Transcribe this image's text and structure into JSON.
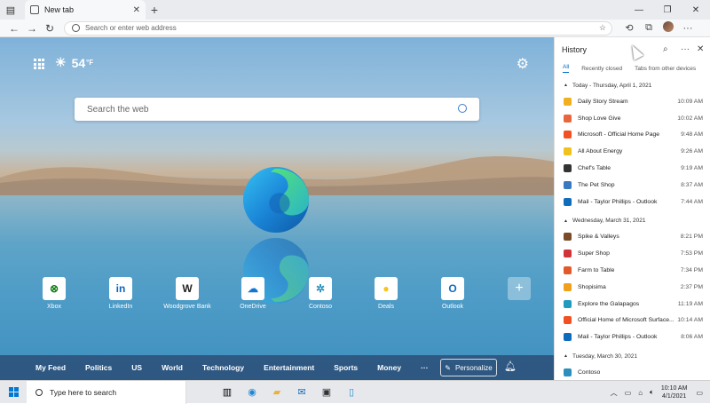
{
  "browser": {
    "tab_title": "New tab",
    "address_placeholder": "Search or enter web address"
  },
  "newtab": {
    "temperature": "54",
    "temp_unit": "°F",
    "search_placeholder": "Search the web",
    "tiles": [
      {
        "label": "Xbox",
        "icon": "xbox-icon",
        "glyph": "⊗",
        "color": "#107c10"
      },
      {
        "label": "LinkedIn",
        "icon": "linkedin-icon",
        "glyph": "in",
        "color": "#0a66c2"
      },
      {
        "label": "Woodgrove Bank",
        "icon": "woodgrove-bank-icon",
        "glyph": "W",
        "color": "#222222"
      },
      {
        "label": "OneDrive",
        "icon": "onedrive-icon",
        "glyph": "☁",
        "color": "#0f78d4"
      },
      {
        "label": "Contoso",
        "icon": "contoso-icon",
        "glyph": "✲",
        "color": "#2a8fbd"
      },
      {
        "label": "Deals",
        "icon": "deals-icon",
        "glyph": "●",
        "color": "#f5c518"
      },
      {
        "label": "Outlook",
        "icon": "outlook-icon",
        "glyph": "O",
        "color": "#0f6cbd"
      }
    ],
    "feed": [
      "My Feed",
      "Politics",
      "US",
      "World",
      "Technology",
      "Entertainment",
      "Sports",
      "Money",
      "···"
    ],
    "personalize_label": "Personalize"
  },
  "history": {
    "title": "History",
    "tabs": [
      "All",
      "Recently closed",
      "Tabs from other devices"
    ],
    "groups": [
      {
        "label": "Today - Thursday, April 1, 2021",
        "items": [
          {
            "title": "Daily Story Stream",
            "time": "10:09 AM",
            "color": "#f2b01e"
          },
          {
            "title": "Shop Love Give",
            "time": "10:02 AM",
            "color": "#e8663d"
          },
          {
            "title": "Microsoft - Official Home Page",
            "time": "9:48 AM",
            "color": "#f25022"
          },
          {
            "title": "All About Energy",
            "time": "9:26 AM",
            "color": "#f3c11b"
          },
          {
            "title": "Chef's Table",
            "time": "9:19 AM",
            "color": "#333333"
          },
          {
            "title": "The Pet Shop",
            "time": "8:37 AM",
            "color": "#3a78c2"
          },
          {
            "title": "Mail - Taylor Phillips - Outlook",
            "time": "7:44 AM",
            "color": "#0f6cbd"
          }
        ]
      },
      {
        "label": "Wednesday, March 31, 2021",
        "items": [
          {
            "title": "Spike & Valleys",
            "time": "8:21 PM",
            "color": "#7a4b2a"
          },
          {
            "title": "Super Shop",
            "time": "7:53 PM",
            "color": "#d13438"
          },
          {
            "title": "Farm to Table",
            "time": "7:34 PM",
            "color": "#e05a2b"
          },
          {
            "title": "Shopisima",
            "time": "2:37 PM",
            "color": "#f0a01a"
          },
          {
            "title": "Explore the Galapagos",
            "time": "11:19 AM",
            "color": "#1f9bbf"
          },
          {
            "title": "Official Home of Microsoft Surface...",
            "time": "10:14 AM",
            "color": "#f25022"
          },
          {
            "title": "Mail - Taylor Phillips - Outlook",
            "time": "8:06 AM",
            "color": "#0f6cbd"
          }
        ]
      },
      {
        "label": "Tuesday, March 30, 2021",
        "items": [
          {
            "title": "Contoso",
            "time": "",
            "color": "#2a8fbd"
          }
        ]
      }
    ]
  },
  "taskbar": {
    "search_placeholder": "Type here to search",
    "time": "10:10 AM",
    "date": "4/1/2021"
  }
}
